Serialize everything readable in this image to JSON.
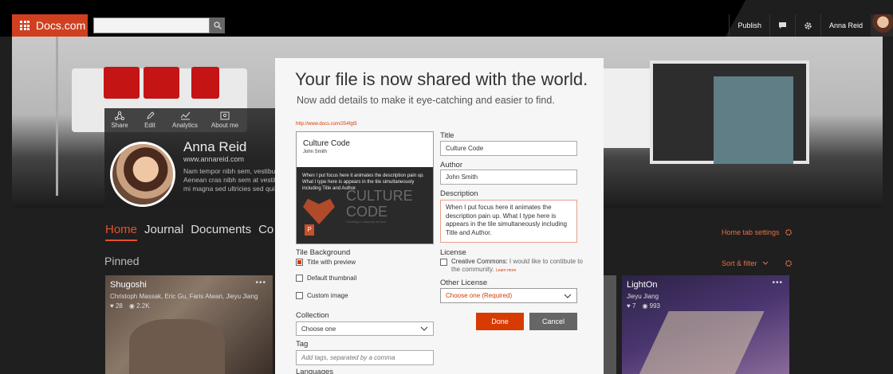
{
  "topbar": {
    "brand": "Docs.com",
    "search_placeholder": "",
    "publish": "Publish",
    "user_name": "Anna Reid",
    "icons": [
      "app-launcher-icon",
      "search-icon",
      "chat-icon",
      "gear-icon"
    ]
  },
  "profile": {
    "actions": [
      {
        "label": "Share",
        "icon": "share-icon"
      },
      {
        "label": "Edit",
        "icon": "pencil-icon"
      },
      {
        "label": "Analytics",
        "icon": "chart-icon"
      },
      {
        "label": "About me",
        "icon": "id-card-icon"
      }
    ],
    "name": "Anna Reid",
    "url": "www.annareid.com",
    "bio": "Nam tempor nibh sem, vestibu Aenean cras nibh sem at vestibu mi magna sed ultricies sed quis"
  },
  "tabs": [
    "Home",
    "Journal",
    "Documents",
    "Co"
  ],
  "section_title": "Pinned",
  "home_tab_settings": "Home tab settings",
  "sort_filter": "Sort & filter",
  "tiles": [
    {
      "title": "Shugoshi",
      "authors": "Christoph Massak, Eric Gu, Faris Alwan, Jieyu Jiang",
      "likes": "28",
      "views": "2.2K"
    },
    {
      "title": "LightOn",
      "authors": "Jieyu Jiang",
      "likes": "7",
      "views": "993"
    }
  ],
  "modal": {
    "title": "Your file is now shared with the world.",
    "subtitle": "Now add details to make it eye-catching and easier to find.",
    "link": "http://www.docs.com/254fgt5",
    "preview": {
      "title": "Culture Code",
      "author": "John Smith",
      "description": "When I put focus here it animates the description pain up. What I type here is appears in the tile simultaneously including Title and Author.",
      "big_text_1": "CULTURE",
      "big_text_2": "CODE",
      "tagline": "Creating a company we love",
      "ppt": "P"
    },
    "title_label": "Title",
    "title_value": "Culture Code",
    "author_label": "Author",
    "author_value": "John Smith",
    "description_label": "Description",
    "description_value": "When I put focus here it animates the description pain up. What I type here is appears in the tile simultaneously including Title and Author.",
    "tile_bg_label": "Tile Background",
    "tile_bg_options": [
      {
        "label": "Title with preview",
        "checked": true
      },
      {
        "label": "Default thumbnail",
        "checked": false
      },
      {
        "label": "Custom image",
        "checked": false
      }
    ],
    "license_label": "License",
    "cc_label": "Creative Commons:",
    "cc_text": " I would like to contibute to the community.",
    "learn_more": "Learn more",
    "other_license_label": "Other License",
    "other_license_value": "Choose one (Required)",
    "collection_label": "Collection",
    "collection_value": "Choose one",
    "tag_label": "Tag",
    "tag_placeholder": "Add tags, separated by a comma",
    "languages_label": "Languages",
    "done": "Done",
    "cancel": "Cancel"
  },
  "colors": {
    "accent": "#d83b01",
    "brand": "#d04020"
  }
}
